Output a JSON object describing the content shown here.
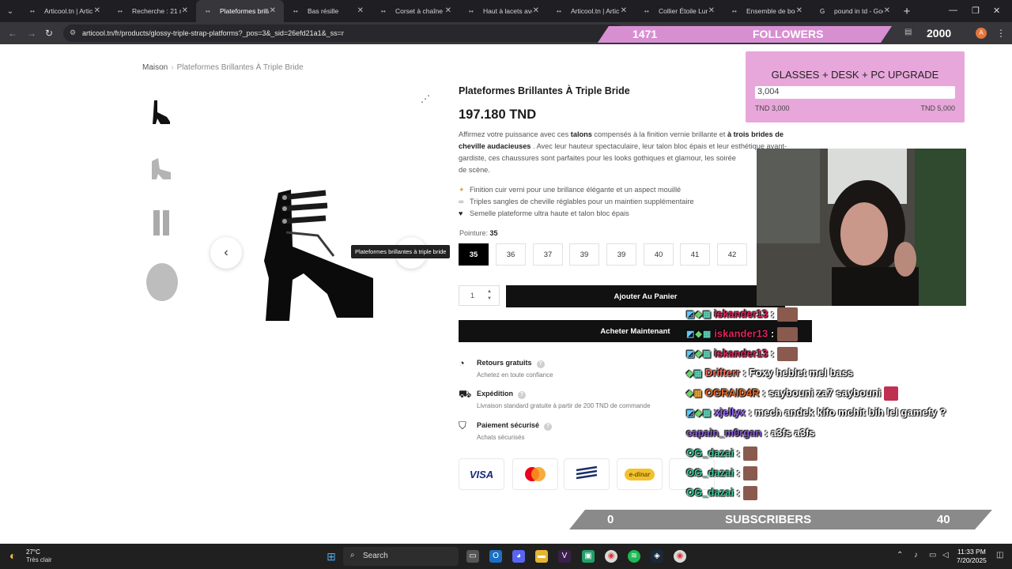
{
  "browser": {
    "tabs": [
      {
        "label": "Articool.tn | Artic"
      },
      {
        "label": "Recherche : 21 ré"
      },
      {
        "label": "Plateformes brilla"
      },
      {
        "label": "Bas résille"
      },
      {
        "label": "Corset à chaîne e"
      },
      {
        "label": "Haut à lacets avec"
      },
      {
        "label": "Articool.tn | Artic"
      },
      {
        "label": "Collier Étoile Lune"
      },
      {
        "label": "Ensemble de bod"
      },
      {
        "label": "pound in td - Goo"
      }
    ],
    "url": "articool.tn/fr/products/glossy-triple-strap-platforms?_pos=3&_sid=26efd21a1&_ss=r"
  },
  "breadcrumb": {
    "home": "Maison",
    "current": "Plateformes Brillantes À Triple Bride"
  },
  "product": {
    "title": "Plateformes Brillantes À Triple Bride",
    "price": "197.180 TND",
    "desc_1": "Affirmez votre puissance avec ces ",
    "desc_2": "talons",
    "desc_3": " compensés à la finition vernie brillante et ",
    "desc_4": "à trois brides de cheville audacieuses",
    "desc_5": " . Avec leur hauteur spectaculaire, leur talon bloc épais et leur esthétique avant-gardiste, ces chaussures sont parfaites pour les looks gothiques et glamour, les soirée",
    "desc_6": "de scène.",
    "features": [
      "Finition cuir verni pour une brillance élégante et un aspect mouillé",
      "Triples sangles de cheville réglables pour un maintien supplémentaire",
      "Semelle plateforme ultra haute et talon bloc épais"
    ],
    "size_label": "Pointure:",
    "size_selected": "35",
    "sizes": [
      "35",
      "36",
      "37",
      "39",
      "39",
      "40",
      "41",
      "42"
    ],
    "qty": "1",
    "add_to_cart": "Ajouter Au Panier",
    "buy_now": "Acheter Maintenant",
    "tooltip": "Plateformes brillantes à triple bride",
    "info": [
      {
        "title": "Retours gratuits",
        "sub": "Achetez en toute confiance"
      },
      {
        "title": "Expédition",
        "sub": "Livraison standard gratuite à partir de 200 TND de commande"
      },
      {
        "title": "Paiement sécurisé",
        "sub": "Achats sécurisés"
      }
    ],
    "payments": [
      "VISA",
      "mastercard",
      "poste",
      "e-dinar"
    ]
  },
  "stream": {
    "followers_count": "1471",
    "followers_label": "FOLLOWERS",
    "followers_goal": "2000",
    "goal_title": "GLASSES + DESK + PC UPGRADE",
    "goal_value": "3,004",
    "goal_min": "TND 3,000",
    "goal_max": "TND 5,000",
    "subs_count": "0",
    "subs_label": "SUBSCRIBERS",
    "subs_goal": "40",
    "chat": [
      {
        "user": "iskander13",
        "sep": " :",
        "msg": "",
        "color": "#e0245e"
      },
      {
        "user": "iskander13",
        "sep": " :",
        "msg": "",
        "color": "#e0245e"
      },
      {
        "user": "iskander13",
        "sep": " :",
        "msg": "",
        "color": "#e0245e"
      },
      {
        "user": "Drifterr",
        "sep": " :",
        "msg": "Foxy heblet mel bass",
        "color": "#ff6a5c"
      },
      {
        "user": "OGRAID4R",
        "sep": " :",
        "msg": "saybouni za7 saybouni",
        "color": "#e86b2b"
      },
      {
        "user": "xjellyx",
        "sep": " :",
        "msg": "mech andek kifo mchit bih lel gamefy ?",
        "color": "#9b6bff"
      },
      {
        "user": "capain_m0rgan",
        "sep": " :",
        "msg": "a3fs a3fs",
        "color": "#8a5bd8"
      },
      {
        "user": "OG_dazai",
        "sep": " :",
        "msg": "",
        "color": "#3bd0a0"
      },
      {
        "user": "OG_dazai",
        "sep": " :",
        "msg": "",
        "color": "#3bd0a0"
      },
      {
        "user": "OG_dazai",
        "sep": " :",
        "msg": "",
        "color": "#3bd0a0"
      }
    ]
  },
  "taskbar": {
    "temp": "27°C",
    "weather": "Très clair",
    "search": "Search",
    "time": "11:33 PM",
    "date": "7/20/2025"
  }
}
